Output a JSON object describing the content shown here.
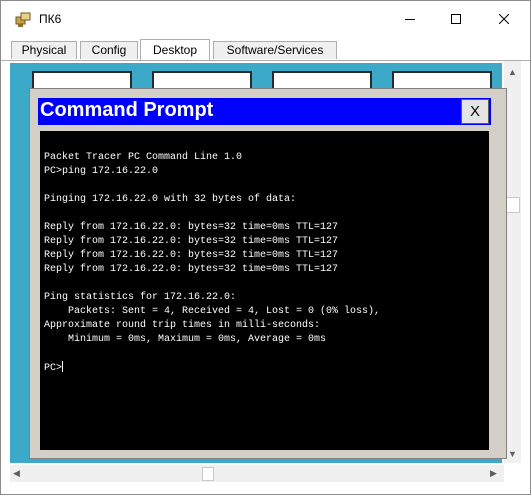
{
  "window": {
    "title": "ПК6"
  },
  "tabs": [
    {
      "label": "Physical",
      "active": false
    },
    {
      "label": "Config",
      "active": false
    },
    {
      "label": "Desktop",
      "active": true
    },
    {
      "label": "Software/Services",
      "active": false
    }
  ],
  "command_prompt": {
    "title": "Command Prompt",
    "close_label": "X",
    "lines": [
      "Packet Tracer PC Command Line 1.0",
      "PC>ping 172.16.22.0",
      "",
      "Pinging 172.16.22.0 with 32 bytes of data:",
      "",
      "Reply from 172.16.22.0: bytes=32 time=0ms TTL=127",
      "Reply from 172.16.22.0: bytes=32 time=0ms TTL=127",
      "Reply from 172.16.22.0: bytes=32 time=0ms TTL=127",
      "Reply from 172.16.22.0: bytes=32 time=0ms TTL=127",
      "",
      "Ping statistics for 172.16.22.0:",
      "    Packets: Sent = 4, Received = 4, Lost = 0 (0% loss),",
      "Approximate round trip times in milli-seconds:",
      "    Minimum = 0ms, Maximum = 0ms, Average = 0ms",
      "",
      "PC>"
    ]
  },
  "colors": {
    "desktop_background": "#3ba9c7",
    "prompt_header": "#0000ff",
    "terminal_background": "#000000",
    "terminal_text": "#ffffff"
  },
  "icons": {
    "app": "packet-tracer-pc-icon",
    "minimize": "minimize-icon",
    "maximize": "maximize-icon",
    "close": "close-icon"
  }
}
